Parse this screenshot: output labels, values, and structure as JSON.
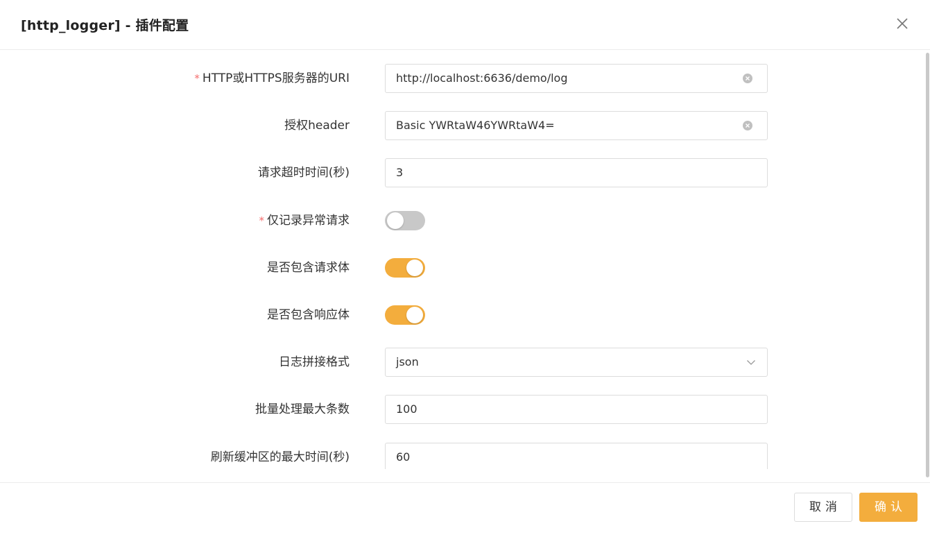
{
  "dialog": {
    "title": "[http_logger] - 插件配置",
    "close_icon": "close-icon"
  },
  "form": {
    "uri": {
      "label": "HTTP或HTTPS服务器的URI",
      "required": true,
      "value": "http://localhost:6636/demo/log"
    },
    "auth_header": {
      "label": "授权header",
      "required": false,
      "value": "Basic YWRtaW46YWRtaW4="
    },
    "timeout": {
      "label": "请求超时时间(秒)",
      "required": false,
      "value": "3"
    },
    "only_error": {
      "label": "仅记录异常请求",
      "required": true,
      "on": false
    },
    "include_req_body": {
      "label": "是否包含请求体",
      "required": false,
      "on": true
    },
    "include_resp_body": {
      "label": "是否包含响应体",
      "required": false,
      "on": true
    },
    "log_format": {
      "label": "日志拼接格式",
      "required": false,
      "value": "json"
    },
    "batch_max": {
      "label": "批量处理最大条数",
      "required": false,
      "value": "100"
    },
    "buffer_duration": {
      "label": "刷新缓冲区的最大时间(秒)",
      "required": false,
      "value": "60"
    }
  },
  "footer": {
    "cancel_label": "取消",
    "ok_label": "确认"
  },
  "colors": {
    "accent": "#f3ad3d",
    "required_mark": "#f56c6c",
    "switch_off": "#c8c8c8"
  }
}
